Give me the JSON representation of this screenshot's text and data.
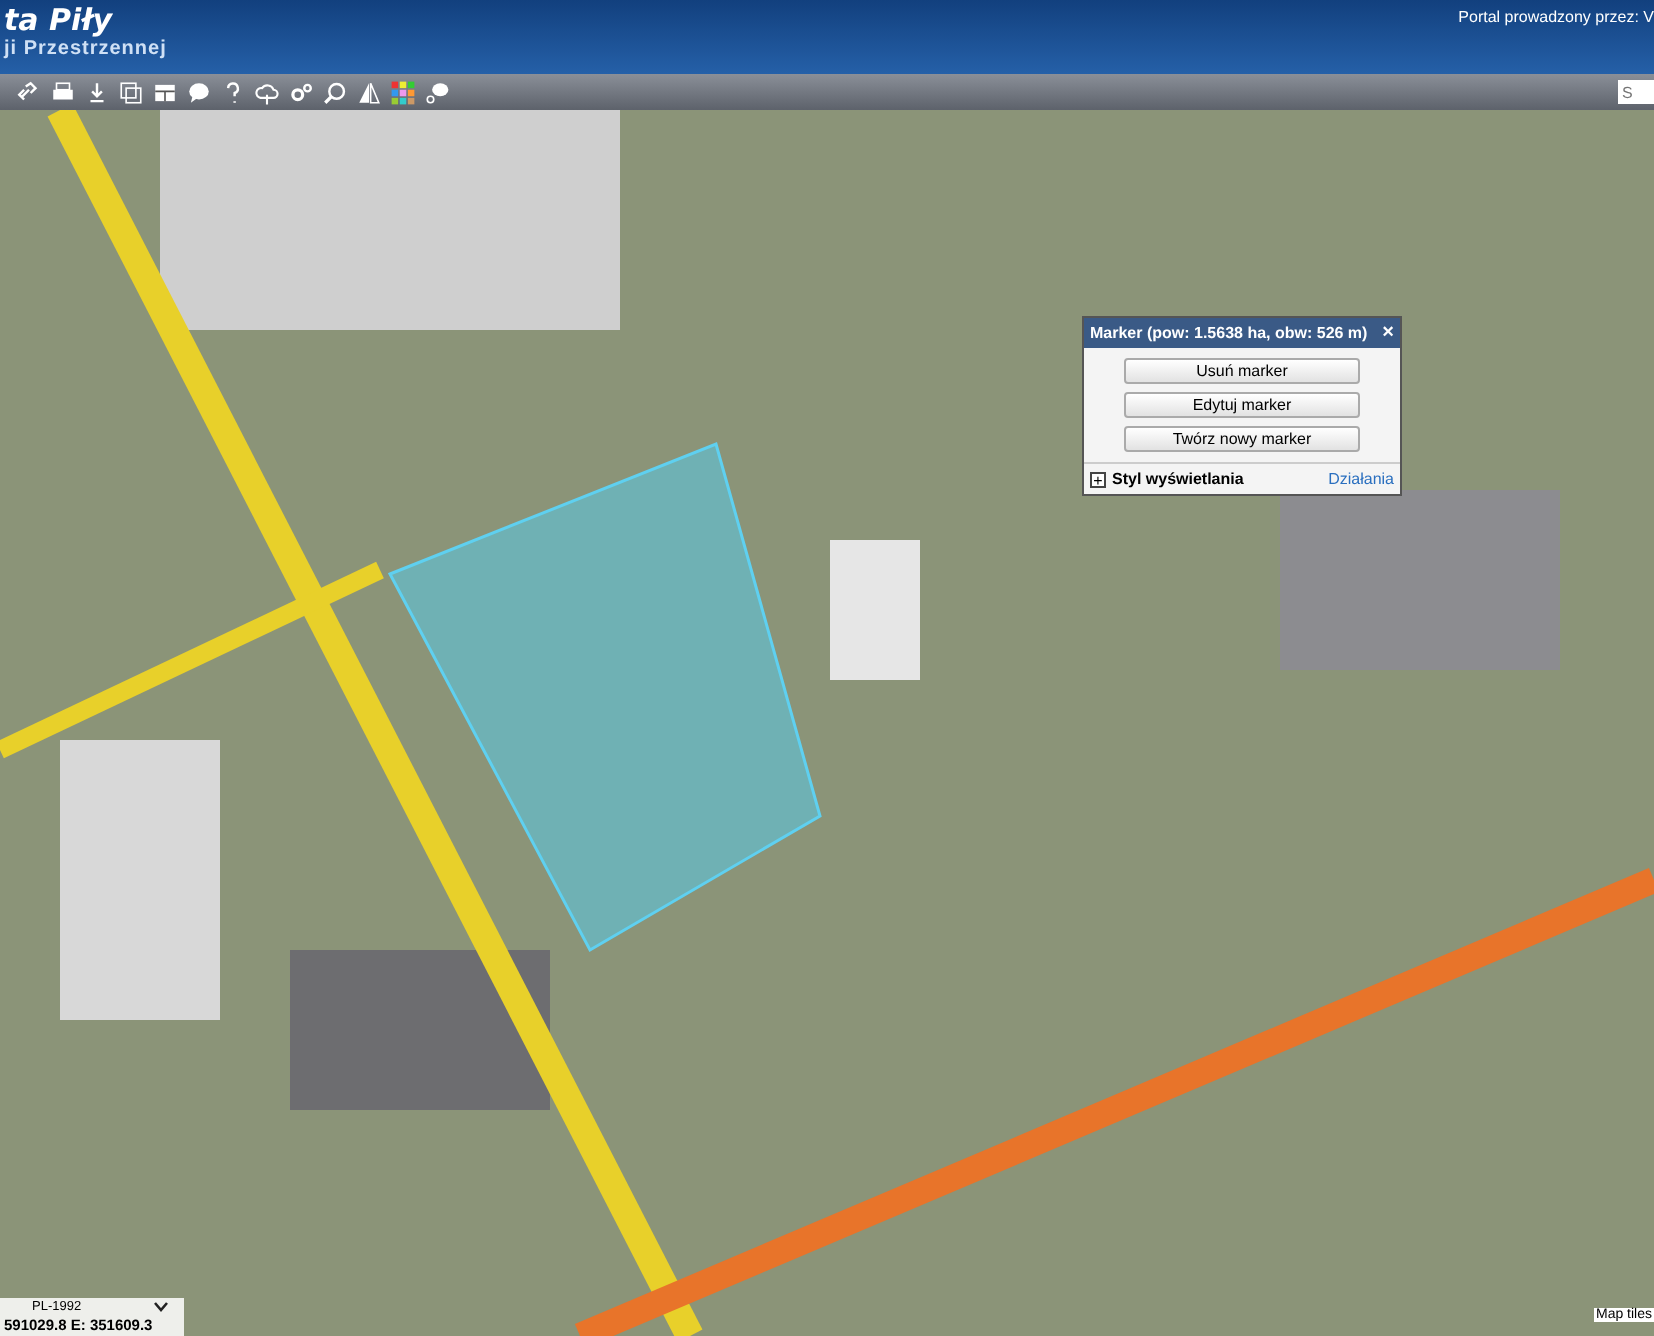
{
  "header": {
    "title": "ta Piły",
    "subtitle": "ji Przestrzennej",
    "operator": "Portal prowadzony przez: V"
  },
  "toolbar": {
    "search_placeholder": "S"
  },
  "marker_popup": {
    "title": "Marker (pow: 1.5638 ha, obw: 526 m)",
    "close": "×",
    "buttons": [
      "Usuń marker",
      "Edytuj marker",
      "Twórz nowy marker"
    ],
    "expander": "+",
    "section": "Styl wyświetlania",
    "action": "Działania"
  },
  "coordinates": {
    "system": "PL-1992",
    "readout": "591029.8  E: 351609.3"
  },
  "attribution": "Map tiles"
}
